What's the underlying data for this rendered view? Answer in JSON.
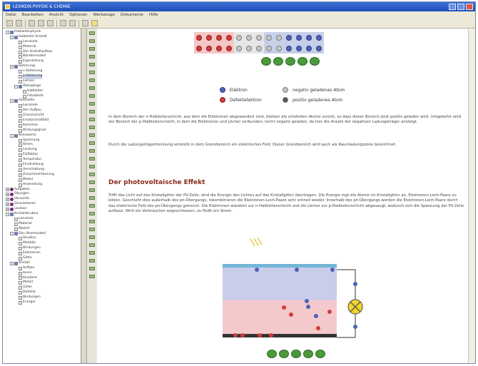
{
  "window": {
    "title": "LEXIKON PHYSIK & CHEMIE"
  },
  "menu": [
    "Datei",
    "Bearbeiten",
    "Ansicht",
    "Optionen",
    "Werkzeuge",
    "Dokumente",
    "Hilfe"
  ],
  "tree": [
    {
      "label": "Halbleiterphysik",
      "level": 0,
      "box": "-",
      "icon": "folder"
    },
    {
      "label": "Halbleiter Kristall",
      "level": 1,
      "box": "-",
      "icon": "folder"
    },
    {
      "label": "Lernziele",
      "level": 2,
      "box": "",
      "icon": "doc"
    },
    {
      "label": "Material",
      "level": 2,
      "box": "",
      "icon": "doc"
    },
    {
      "label": "Der Kristallaufbau",
      "level": 2,
      "box": "",
      "icon": "doc"
    },
    {
      "label": "Bändermodell",
      "level": 2,
      "box": "",
      "icon": "doc"
    },
    {
      "label": "Eigenleitung",
      "level": 2,
      "box": "",
      "icon": "doc"
    },
    {
      "label": "Dotierung",
      "level": 1,
      "box": "-",
      "icon": "folder"
    },
    {
      "label": "n-Dotierung",
      "level": 2,
      "box": "",
      "icon": "doc"
    },
    {
      "label": "p-Dotierung",
      "level": 2,
      "box": "",
      "icon": "doc",
      "selected": true
    },
    {
      "label": "Lernen",
      "level": 2,
      "box": "",
      "icon": "doc"
    },
    {
      "label": "Übergänge",
      "level": 2,
      "box": "-",
      "icon": "folder"
    },
    {
      "label": "Halbleiter",
      "level": 3,
      "box": "",
      "icon": "doc"
    },
    {
      "label": "Fotodiode",
      "level": 3,
      "box": "",
      "icon": "doc"
    },
    {
      "label": "Solarzelle",
      "level": 1,
      "box": "-",
      "icon": "folder"
    },
    {
      "label": "Lernziele",
      "level": 2,
      "box": "",
      "icon": "doc"
    },
    {
      "label": "Der Aufbau",
      "level": 2,
      "box": "",
      "icon": "doc"
    },
    {
      "label": "Grenzschicht",
      "level": 2,
      "box": "",
      "icon": "doc"
    },
    {
      "label": "Ersatzschaltbild",
      "level": 2,
      "box": "",
      "icon": "doc"
    },
    {
      "label": "Kennlinie",
      "level": 2,
      "box": "",
      "icon": "doc"
    },
    {
      "label": "Wirkungsgrad",
      "level": 2,
      "box": "",
      "icon": "doc"
    },
    {
      "label": "Kennwerte",
      "level": 1,
      "box": "-",
      "icon": "folder"
    },
    {
      "label": "Spannung",
      "level": 2,
      "box": "",
      "icon": "doc"
    },
    {
      "label": "Strom",
      "level": 2,
      "box": "",
      "icon": "doc"
    },
    {
      "label": "Leistung",
      "level": 2,
      "box": "",
      "icon": "doc"
    },
    {
      "label": "Füllfaktor",
      "level": 2,
      "box": "",
      "icon": "doc"
    },
    {
      "label": "Temperatur",
      "level": 2,
      "box": "",
      "icon": "doc"
    },
    {
      "label": "Einstrahlung",
      "level": 2,
      "box": "",
      "icon": "doc"
    },
    {
      "label": "Verschaltung",
      "level": 2,
      "box": "",
      "icon": "doc"
    },
    {
      "label": "Zusammenfassung",
      "level": 2,
      "box": "",
      "icon": "doc"
    },
    {
      "label": "Modul",
      "level": 2,
      "box": "",
      "icon": "doc"
    },
    {
      "label": "Anwendung",
      "level": 2,
      "box": "",
      "icon": "doc"
    },
    {
      "label": "Aufgaben",
      "level": 0,
      "box": "+",
      "icon": "bullet"
    },
    {
      "label": "Übungen",
      "level": 0,
      "box": "+",
      "icon": "bullet"
    },
    {
      "label": "Versuche",
      "level": 0,
      "box": "+",
      "icon": "bullet"
    },
    {
      "label": "Simulationen",
      "level": 0,
      "box": "+",
      "icon": "bullet"
    },
    {
      "label": "Lexikon",
      "level": 0,
      "box": "+",
      "icon": "bullet"
    },
    {
      "label": "Kristallstruktur",
      "level": 0,
      "box": "-",
      "icon": "folder"
    },
    {
      "label": "Lernziele",
      "level": 1,
      "box": "",
      "icon": "doc"
    },
    {
      "label": "Material",
      "level": 1,
      "box": "",
      "icon": "doc"
    },
    {
      "label": "Modell",
      "level": 1,
      "box": "",
      "icon": "doc"
    },
    {
      "label": "Das Atommodell",
      "level": 1,
      "box": "-",
      "icon": "folder"
    },
    {
      "label": "Struktur",
      "level": 2,
      "box": "",
      "icon": "doc"
    },
    {
      "label": "Modelle",
      "level": 2,
      "box": "",
      "icon": "doc"
    },
    {
      "label": "Bindungen",
      "level": 2,
      "box": "",
      "icon": "doc"
    },
    {
      "label": "Elektronen",
      "level": 2,
      "box": "",
      "icon": "doc"
    },
    {
      "label": "Gitter",
      "level": 2,
      "box": "",
      "icon": "doc"
    },
    {
      "label": "Kristall",
      "level": 1,
      "box": "-",
      "icon": "folder"
    },
    {
      "label": "Aufbau",
      "level": 2,
      "box": "",
      "icon": "doc"
    },
    {
      "label": "Ionen",
      "level": 2,
      "box": "",
      "icon": "doc"
    },
    {
      "label": "Kovalent",
      "level": 2,
      "box": "",
      "icon": "doc"
    },
    {
      "label": "Metall",
      "level": 2,
      "box": "",
      "icon": "doc"
    },
    {
      "label": "Gitter",
      "level": 2,
      "box": "",
      "icon": "doc"
    },
    {
      "label": "Defekte",
      "level": 2,
      "box": "",
      "icon": "doc"
    },
    {
      "label": "Bindungen",
      "level": 2,
      "box": "",
      "icon": "doc"
    },
    {
      "label": "Energie",
      "level": 2,
      "box": "",
      "icon": "doc"
    }
  ],
  "legend": {
    "electron": "Elektron",
    "hole": "Defektelektron",
    "neg_atom": "negativ geladenes Atom",
    "pos_atom": "positiv geladenes Atom"
  },
  "paragraphs": {
    "p1": "In dem Bereich der n-Halbleiterschicht, aus dem die Elektronen abgewandert sind, bleiben die ortsfesten Atome zurück, so dass dieser Bereich jetzt positiv geladen wird. Umgekehrt wird der Bereich der p-Halbleiterschicht, in dem die Elektronen und Löcher verbunden, leicht negativ geladen, da hier die Anzahl der negativen Ladungsträger ansteigt.",
    "p2": "Durch die Ladungsträgertrennung entsteht in dem Grenzbereich ein elektrisches Feld. Dieser Grenzbereich wird auch als Raumladungszone bezeichnet.",
    "title": "Der photovoltaische Effekt",
    "p3": "Trifft das Licht auf das Kristallgitter der PV-Zelle, wird die Energie des Lichtes auf das Kristallgitter übertragen. Die Energie regt die Atome im Kristallgitter an, Elektronen-Loch-Paare zu bilden. Geschieht dies außerhalb des pn-Übergangs, rekombinieren die Elektronen-Loch-Paare sehr schnell wieder. Innerhalb des pn-Übergangs werden die Elektronen-Loch-Paare durch das elektrische Feld des pn-Übergangs getrennt. Die Elektronen wandern zur n-Halbleiterschicht und die Löcher zur p-Halbleiterschicht abgesaugt, wodurch sich die Spannung der PV-Zelle aufbaut. Wird ein Verbraucher angeschlossen, so fließt ein Strom."
  },
  "lattice": {
    "columns": [
      "p",
      "p",
      "p",
      "p",
      "m",
      "m",
      "m",
      "n",
      "n",
      "n",
      "n",
      "n",
      "n"
    ],
    "top": [
      "red",
      "red",
      "red",
      "red",
      "gray",
      "gray",
      "gray",
      "gray",
      "gray",
      "blue",
      "blue",
      "blue",
      "blue"
    ],
    "bottom": [
      "red",
      "red",
      "red",
      "red",
      "gray",
      "gray",
      "gray",
      "gray",
      "gray",
      "blue",
      "blue",
      "blue",
      "blue"
    ]
  }
}
